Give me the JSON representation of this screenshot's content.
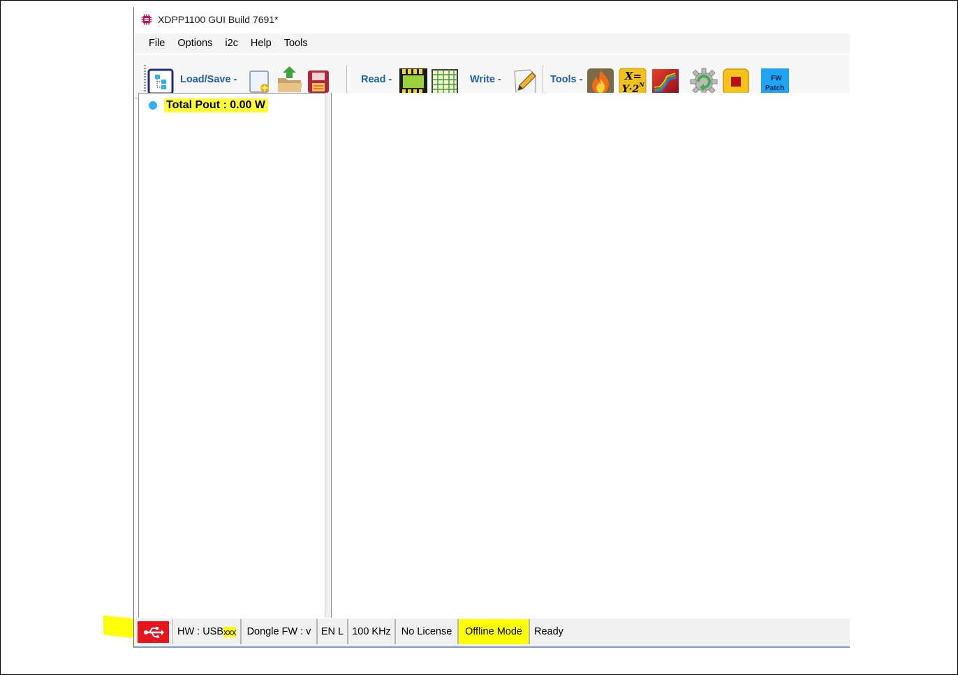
{
  "window": {
    "title": "XDPP1100 GUI Build 7691*"
  },
  "menubar": {
    "items": [
      "File",
      "Options",
      "i2c",
      "Help",
      "Tools"
    ]
  },
  "toolbar": {
    "load_save_label": "Load/Save -",
    "read_label": "Read -",
    "write_label": "Write -",
    "tools_label": "Tools -",
    "formula_icon_top": "X=",
    "formula_icon_bottom": "Y·2",
    "formula_icon_exp": "N",
    "fw_patch_top": "FW",
    "fw_patch_bottom": "Patch",
    "icons": [
      "tree-view-icon",
      "new-file-icon",
      "open-folder-icon",
      "save-icon",
      "chip-read-icon",
      "table-grid-icon",
      "pencil-write-icon",
      "fire-icon",
      "formula-icon",
      "chart-icon",
      "gear-refresh-icon",
      "stop-icon",
      "fw-patch-icon"
    ]
  },
  "tree": {
    "total_pout_label": "Total Pout : 0.00 W"
  },
  "statusbar": {
    "usb_icon": "usb-icon",
    "hw_prefix": "HW : USB",
    "hw_suffix": "xxx",
    "dongle_fw": "Dongle FW : v",
    "en": "EN L",
    "i2c_speed": "100 KHz",
    "license": "No License",
    "mode": "Offline Mode",
    "state": "Ready"
  },
  "colors": {
    "highlight": "#ffff00",
    "accent_text": "#1f5fb0",
    "usb_red": "#e8141b",
    "tree_dot": "#2fb0f0"
  }
}
